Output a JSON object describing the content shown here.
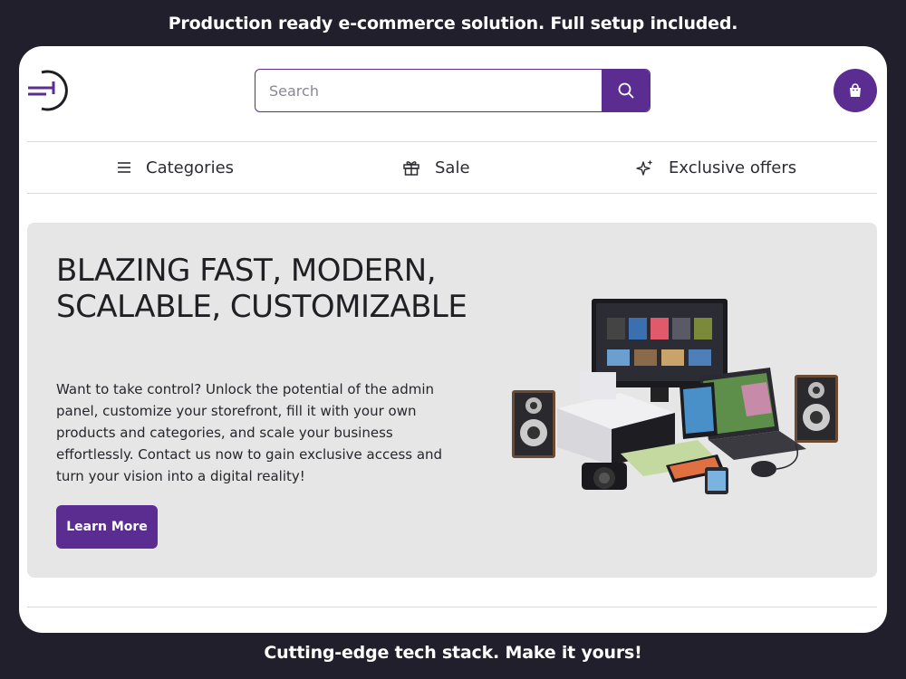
{
  "banners": {
    "top": "Production ready e-commerce solution. Full setup included.",
    "bottom": "Cutting-edge tech stack. Make it yours!"
  },
  "header": {
    "search_placeholder": "Search"
  },
  "nav": {
    "categories": "Categories",
    "sale": "Sale",
    "exclusive": "Exclusive offers"
  },
  "hero": {
    "title": "BLAZING FAST, MODERN, SCALABLE, CUSTOMIZABLE",
    "text": "Want to take control? Unlock the potential of the admin panel, customize your storefront, fill it with your own products and categories, and scale your business effortlessly. Contact us now to gain exclusive access and turn your vision into a digital reality!",
    "button": "Learn More"
  },
  "colors": {
    "accent": "#5c2d91",
    "frame_bg": "#201f2b",
    "hero_bg": "#e6e6e6"
  }
}
